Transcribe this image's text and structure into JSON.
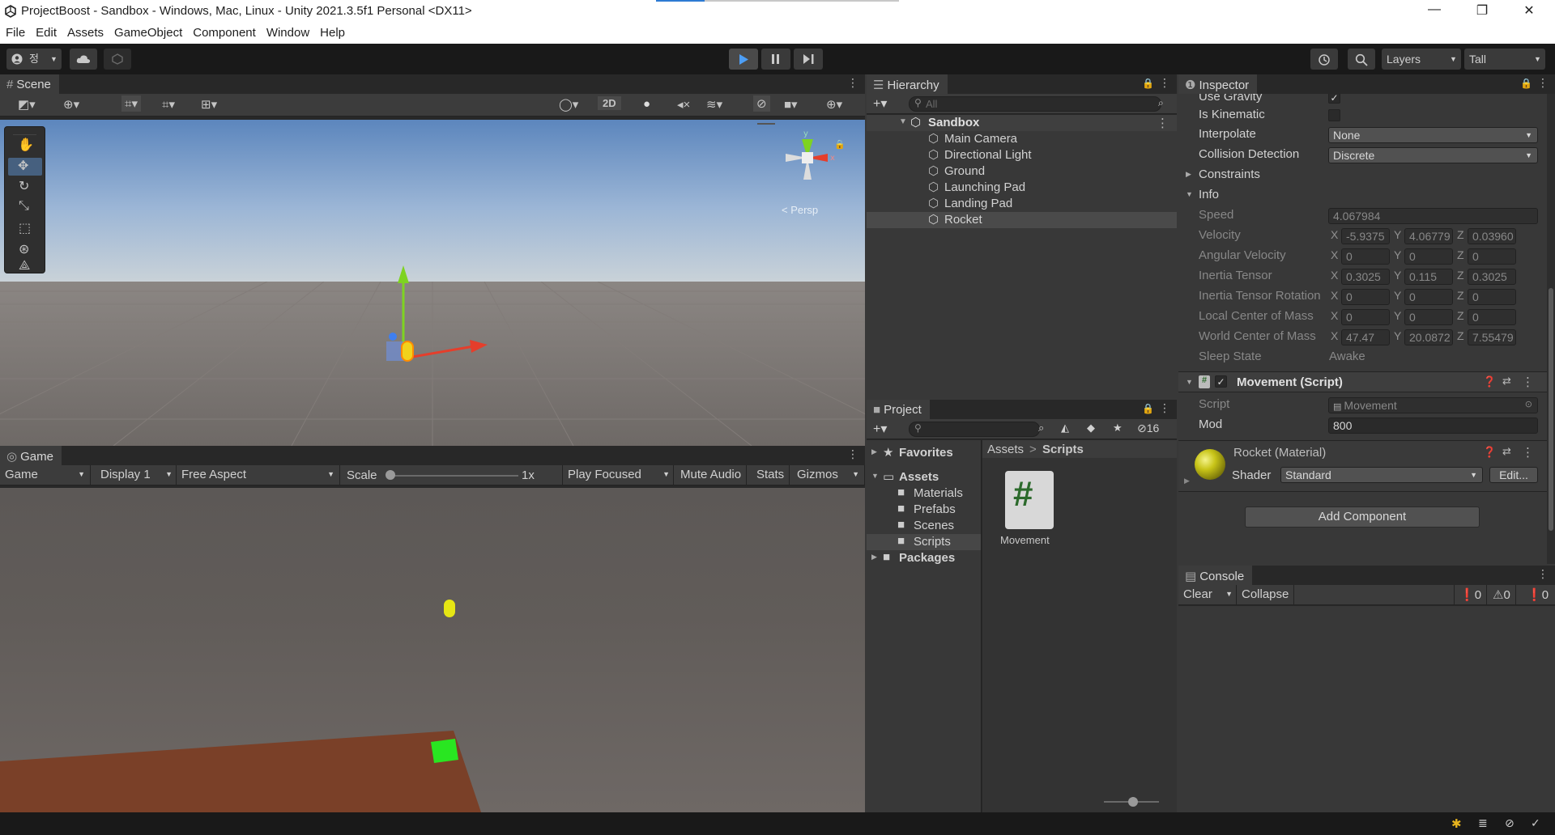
{
  "window": {
    "title": "ProjectBoost - Sandbox - Windows, Mac, Linux - Unity 2021.3.5f1 Personal <DX11>",
    "minimize": "—",
    "restore": "❐",
    "close": "✕"
  },
  "menu": [
    "File",
    "Edit",
    "Assets",
    "GameObject",
    "Component",
    "Window",
    "Help"
  ],
  "toolbar": {
    "account_label": "정",
    "layers_label": "Layers",
    "layout_label": "Tall"
  },
  "scene": {
    "tab": "Scene",
    "toggle_2d": "2D",
    "persp_label": "< Persp"
  },
  "game": {
    "tab": "Game",
    "mode": "Game",
    "display": "Display 1",
    "aspect": "Free Aspect",
    "scale_label": "Scale",
    "scale_value": "1x",
    "play_focused": "Play Focused",
    "mute_audio": "Mute Audio",
    "stats": "Stats",
    "gizmos": "Gizmos"
  },
  "hierarchy": {
    "tab": "Hierarchy",
    "search_placeholder": "All",
    "scene_name": "Sandbox",
    "objects": [
      "Main Camera",
      "Directional Light",
      "Ground",
      "Launching Pad",
      "Landing Pad",
      "Rocket"
    ]
  },
  "project": {
    "tab": "Project",
    "hidden_count": "16",
    "favorites": "Favorites",
    "assets": "Assets",
    "folders": [
      "Materials",
      "Prefabs",
      "Scenes",
      "Scripts"
    ],
    "packages": "Packages",
    "breadcrumb_root": "Assets",
    "breadcrumb_sep": ">",
    "breadcrumb_current": "Scripts",
    "asset_name": "Movement",
    "asset_glyph": "#"
  },
  "inspector": {
    "tab": "Inspector",
    "use_gravity": "Use Gravity",
    "is_kinematic": "Is Kinematic",
    "interpolate_label": "Interpolate",
    "interpolate_value": "None",
    "collision_label": "Collision Detection",
    "collision_value": "Discrete",
    "constraints": "Constraints",
    "info": "Info",
    "speed_label": "Speed",
    "speed_value": "4.067984",
    "vectors": [
      {
        "label": "Velocity",
        "x": "-5.9375",
        "y": "4.06779",
        "z": "0.03960"
      },
      {
        "label": "Angular Velocity",
        "x": "0",
        "y": "0",
        "z": "0"
      },
      {
        "label": "Inertia Tensor",
        "x": "0.3025",
        "y": "0.115",
        "z": "0.3025"
      },
      {
        "label": "Inertia Tensor Rotation",
        "x": "0",
        "y": "0",
        "z": "0"
      },
      {
        "label": "Local Center of Mass",
        "x": "0",
        "y": "0",
        "z": "0"
      },
      {
        "label": "World Center of Mass",
        "x": "47.47",
        "y": "20.0872",
        "z": "7.55479"
      }
    ],
    "axis_x": "X",
    "axis_y": "Y",
    "axis_z": "Z",
    "sleep_label": "Sleep State",
    "sleep_value": "Awake",
    "movement_title": "Movement (Script)",
    "script_label": "Script",
    "script_value": "Movement",
    "mod_label": "Mod",
    "mod_value": "800",
    "material_title": "Rocket (Material)",
    "shader_label": "Shader",
    "shader_value": "Standard",
    "edit_button": "Edit...",
    "add_component": "Add Component"
  },
  "console": {
    "tab": "Console",
    "clear": "Clear",
    "collapse": "Collapse",
    "info_count": "0",
    "warn_count": "0",
    "error_count": "0"
  }
}
